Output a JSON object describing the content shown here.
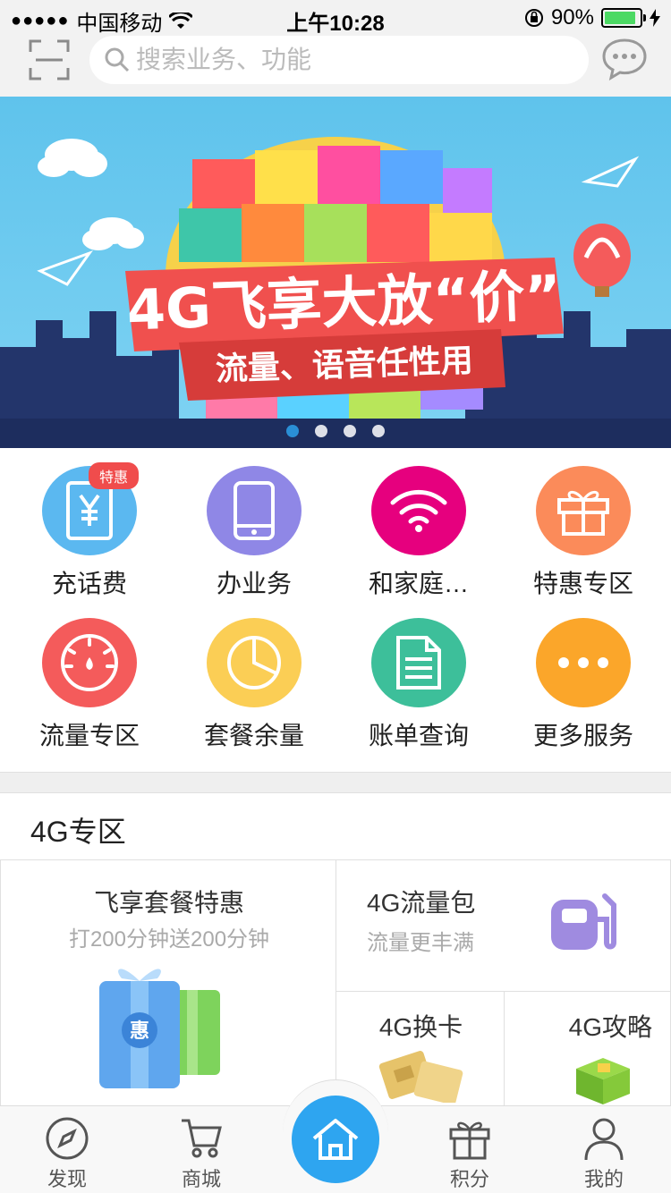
{
  "status_bar": {
    "carrier": "中国移动",
    "signal": "●●●●●",
    "time": "上午10:28",
    "battery": "90%",
    "battery_level": 0.9
  },
  "search": {
    "placeholder": "搜索业务、功能"
  },
  "banner": {
    "slide_count": 4,
    "active_slide": 1
  },
  "services": [
    {
      "label": "充话费",
      "badge": "特惠",
      "icon": "yuan-card-icon",
      "color": "#5bb8f0"
    },
    {
      "label": "办业务",
      "badge": "",
      "icon": "tablet-icon",
      "color": "#8f87e6"
    },
    {
      "label": "和家庭…",
      "badge": "",
      "icon": "wifi-icon",
      "color": "#e6007e"
    },
    {
      "label": "特惠专区",
      "badge": "",
      "icon": "gift-icon",
      "color": "#fb8b5a"
    },
    {
      "label": "流量专区",
      "badge": "",
      "icon": "gauge-icon",
      "color": "#f45b5b"
    },
    {
      "label": "套餐余量",
      "badge": "",
      "icon": "pie-chart-icon",
      "color": "#fbce55"
    },
    {
      "label": "账单查询",
      "badge": "",
      "icon": "document-icon",
      "color": "#3dbf9a"
    },
    {
      "label": "更多服务",
      "badge": "",
      "icon": "more-icon",
      "color": "#fba62a"
    }
  ],
  "zone": {
    "title": "4G专区",
    "tiles": [
      {
        "title": "飞享套餐特惠",
        "subtitle": "打200分钟送200分钟"
      },
      {
        "title": "4G流量包",
        "subtitle": "流量更丰满"
      },
      {
        "title": "4G换卡",
        "subtitle": ""
      },
      {
        "title": "4G攻略",
        "subtitle": ""
      }
    ]
  },
  "tabs": {
    "discover": "发现",
    "mall": "商城",
    "home": "home-icon",
    "points": "积分",
    "mine": "我的"
  }
}
